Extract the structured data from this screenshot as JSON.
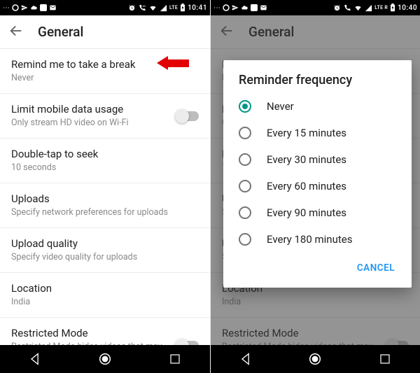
{
  "left": {
    "statusbar": {
      "network": "LTE",
      "time": "10:41"
    },
    "appbar": {
      "title": "General"
    },
    "settings": [
      {
        "title": "Remind me to take a break",
        "subtitle": "Never",
        "toggle": false
      },
      {
        "title": "Limit mobile data usage",
        "subtitle": "Only stream HD video on Wi-Fi",
        "toggle": true
      },
      {
        "title": "Double-tap to seek",
        "subtitle": "10 seconds",
        "toggle": false
      },
      {
        "title": "Uploads",
        "subtitle": "Specify network preferences for uploads",
        "toggle": false
      },
      {
        "title": "Upload quality",
        "subtitle": "Specify video quality for uploads",
        "toggle": false
      },
      {
        "title": "Location",
        "subtitle": "India",
        "toggle": false
      },
      {
        "title": "Restricted Mode",
        "subtitle": "Restricted Mode hides videos that may contain inappropriate content that is",
        "toggle": true
      }
    ]
  },
  "right": {
    "statusbar": {
      "network": "LTE R",
      "time": "10:40"
    },
    "appbar": {
      "title": "General"
    },
    "dialog": {
      "title": "Reminder frequency",
      "options": [
        {
          "label": "Never",
          "selected": true
        },
        {
          "label": "Every 15 minutes",
          "selected": false
        },
        {
          "label": "Every 30 minutes",
          "selected": false
        },
        {
          "label": "Every 60 minutes",
          "selected": false
        },
        {
          "label": "Every 90 minutes",
          "selected": false
        },
        {
          "label": "Every 180 minutes",
          "selected": false
        }
      ],
      "cancel": "CANCEL"
    }
  }
}
